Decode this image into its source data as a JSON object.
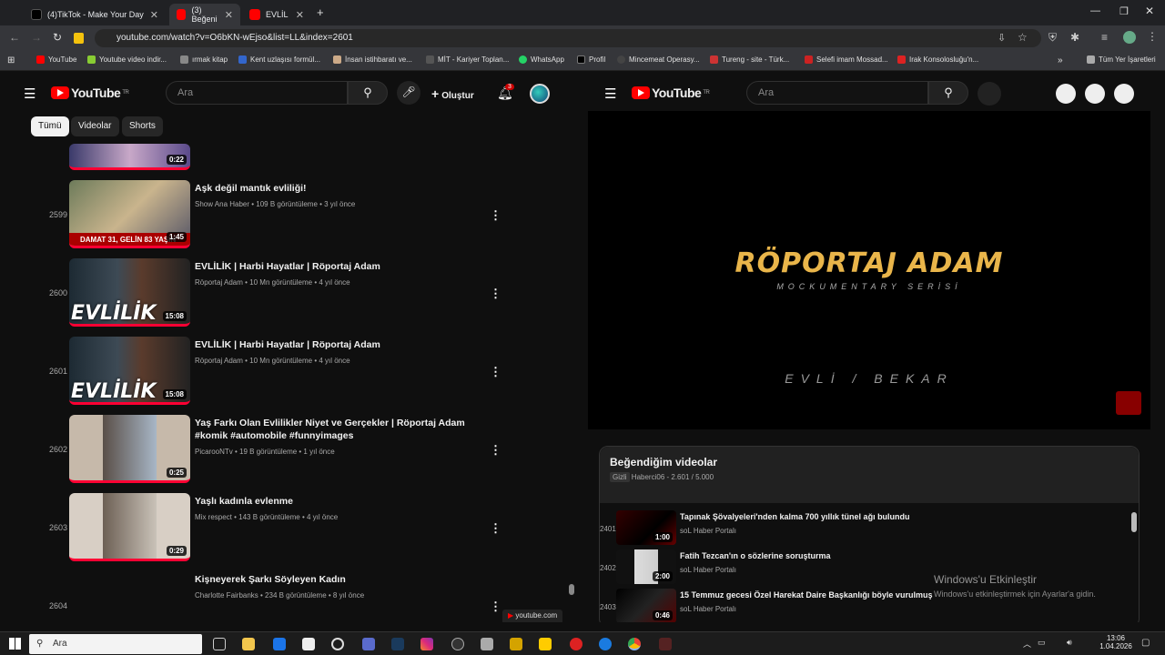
{
  "tabs": [
    {
      "label": "(4)TikTok - Make Your Day"
    },
    {
      "label": "(3) Beğeni"
    },
    {
      "label": "EVLİL"
    }
  ],
  "address": {
    "url": "youtube.com/watch?v=O6bKN-wEjso&list=LL&index=2601"
  },
  "bookmarks": [
    {
      "label": "YouTube"
    },
    {
      "label": "Youtube video indir..."
    },
    {
      "label": "ırmak kitap"
    },
    {
      "label": "Kent uzlaşısı formül..."
    },
    {
      "label": "İnsan istihbaratı ve..."
    },
    {
      "label": "MİT - Kariyer Toplan..."
    },
    {
      "label": "WhatsApp"
    },
    {
      "label": "Profil"
    },
    {
      "label": "Mincemeat Operasy..."
    },
    {
      "label": "Tureng - site - Türk..."
    },
    {
      "label": "Selefi imam Mossad..."
    },
    {
      "label": "Irak Konsolosluğu'n..."
    }
  ],
  "bookmarks_other": "Tüm Yer İşaretleri",
  "left": {
    "logo": "YouTube",
    "logo_sup": "TR",
    "search_placeholder": "Ara",
    "create_label": "Oluştur",
    "notif_count": "3",
    "chips": [
      {
        "label": "Tümü"
      },
      {
        "label": "Videolar"
      },
      {
        "label": "Shorts"
      }
    ],
    "first_duration": "0:22",
    "videos": [
      {
        "index": "2599",
        "title": "Aşk değil mantık evliliği!",
        "meta": "Show Ana Haber • 109 B görüntüleme • 3 yıl önce",
        "duration": "1:45",
        "caption": "DAMAT 31, GELİN 83 YAŞIN"
      },
      {
        "index": "2600",
        "title": "EVLİLİK | Harbi Hayatlar | Röportaj Adam",
        "meta": "Röportaj Adam • 10 Mn görüntüleme • 4 yıl önce",
        "duration": "15:08",
        "caption": "EVLİLİK"
      },
      {
        "index": "2601",
        "title": "EVLİLİK | Harbi Hayatlar | Röportaj Adam",
        "meta": "Röportaj Adam • 10 Mn görüntüleme • 4 yıl önce",
        "duration": "15:08",
        "caption": "EVLİLİK"
      },
      {
        "index": "2602",
        "title": "Yaş Farkı Olan Evlilikler Niyet ve Gerçekler | Röportaj Adam #komik #automobile #funnyimages",
        "meta": "PicarooNTv • 19 B görüntüleme • 1 yıl önce",
        "duration": "0:25",
        "caption": ""
      },
      {
        "index": "2603",
        "title": "Yaşlı kadınla evlenme",
        "meta": "Mix respect • 143 B görüntüleme • 4 yıl önce",
        "duration": "0:29",
        "caption": ""
      },
      {
        "index": "2604",
        "title": "Kişneyerek Şarkı Söyleyen Kadın",
        "meta": "Charlotte Fairbanks • 234 B görüntüleme • 8 yıl önce",
        "duration": "",
        "caption": ""
      }
    ],
    "status_url": "youtube.com"
  },
  "right": {
    "logo": "YouTube",
    "logo_sup": "TR",
    "search_placeholder": "Ara",
    "player_title": "RÖPORTAJ ADAM",
    "player_subtitle": "MOCKUMENTARY SERİSİ",
    "player_caption": "EVLİ / BEKAR",
    "playlist_title": "Beğendiğim videolar",
    "playlist_privacy": "Gizli",
    "playlist_owner": "Haberci06",
    "playlist_progress": "2.601 / 5.000",
    "items": [
      {
        "index": "2401",
        "title": "Tapınak Şövalyeleri'nden kalma 700 yıllık tünel ağı bulundu",
        "channel": "soL Haber Portalı",
        "duration": "1:00"
      },
      {
        "index": "2402",
        "title": "Fatih Tezcan'ın o sözlerine soruşturma",
        "channel": "soL Haber Portalı",
        "duration": "2:00"
      },
      {
        "index": "2403",
        "title": "15 Temmuz gecesi Özel Harekat Daire Başkanlığı böyle vurulmuş",
        "channel": "soL Haber Portalı",
        "duration": "0:46"
      }
    ],
    "watermark_title": "Windows'u Etkinleştir",
    "watermark_sub": "Windows'u etkinleştirmek için Ayarlar'a gidin."
  },
  "taskbar": {
    "search": "Ara",
    "time": "13:06",
    "date": "1.04.2026"
  }
}
